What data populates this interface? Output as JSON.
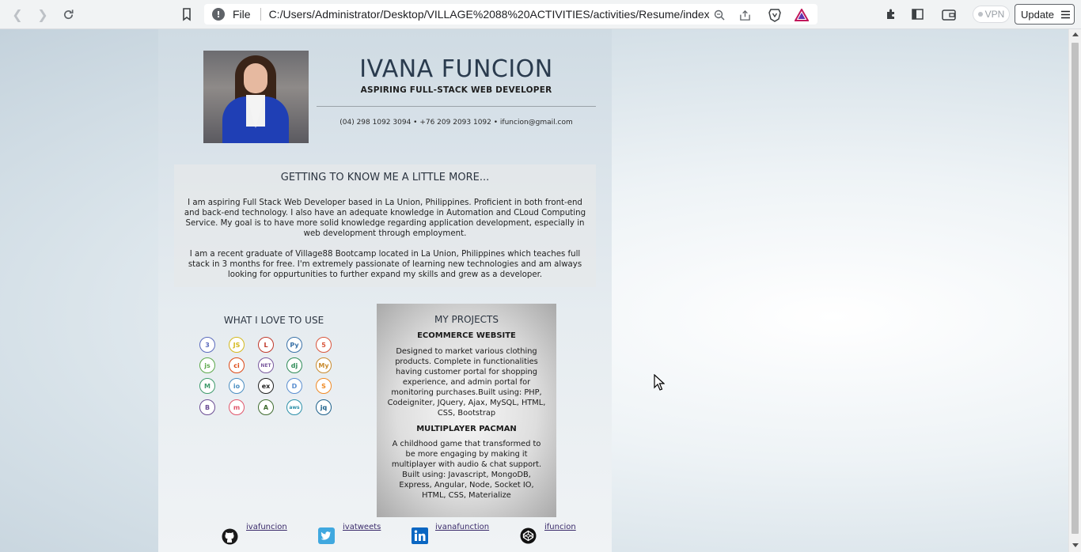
{
  "browser": {
    "url_scheme": "File",
    "url": "C:/Users/Administrator/Desktop/VILLAGE%2088%20ACTIVITIES/activities/Resume/index....",
    "vpn_label": "VPN",
    "update_label": "Update",
    "info_icon": "!"
  },
  "header": {
    "name": "IVANA FUNCION",
    "tagline": "ASPIRING FULL-STACK WEB DEVELOPER",
    "contact": "(04) 298 1092 3094 • +76 209 2093 1092 • ifuncion@gmail.com"
  },
  "about": {
    "title": "GETTING TO KNOW ME A LITTLE MORE...",
    "paragraphs": [
      "I am aspiring Full Stack Web Developer based in La Union, Philippines. Proficient in both front-end and back-end technology. I also have an adequate knowledge in Automation and CLoud Computing Service. My goal is to have more solid knowledge regarding application development, especially in web development through employment.",
      "I am a recent graduate of Village88 Bootcamp located in La Union, Philippines which teaches full stack in 3 months for free. I'm extremely passionate of learning new technologies and am always looking for oppurtunities to further expand my skills and grew as a developer."
    ]
  },
  "tools": {
    "title": "WHAT I LOVE TO USE",
    "icons": [
      {
        "name": "css3-icon",
        "glyph": "3",
        "color": "#5b6bbd"
      },
      {
        "name": "javascript-icon",
        "glyph": "JS",
        "color": "#d4b91e"
      },
      {
        "name": "laravel-icon",
        "glyph": "L",
        "color": "#c0392b"
      },
      {
        "name": "python-icon",
        "glyph": "Py",
        "color": "#3a72a8"
      },
      {
        "name": "html5-icon",
        "glyph": "5",
        "color": "#d9553b"
      },
      {
        "name": "nodejs-icon",
        "glyph": "js",
        "color": "#5ba84a"
      },
      {
        "name": "codeigniter-icon",
        "glyph": "ci",
        "color": "#dd4814"
      },
      {
        "name": "dotnet-icon",
        "glyph": "NET",
        "color": "#7a5a9e"
      },
      {
        "name": "django-icon",
        "glyph": "dj",
        "color": "#2e8b57"
      },
      {
        "name": "mysql-icon",
        "glyph": "My",
        "color": "#c88a2d"
      },
      {
        "name": "mongodb-icon",
        "glyph": "M",
        "color": "#3f9b6b"
      },
      {
        "name": "socketio-icon",
        "glyph": "io",
        "color": "#4a8ec2"
      },
      {
        "name": "express-icon",
        "glyph": "ex",
        "color": "#222222"
      },
      {
        "name": "docker-icon",
        "glyph": "D",
        "color": "#5a8ed0"
      },
      {
        "name": "swift-icon",
        "glyph": "S",
        "color": "#f08a24"
      },
      {
        "name": "bootstrap-icon",
        "glyph": "B",
        "color": "#6a4c93"
      },
      {
        "name": "materialize-icon",
        "glyph": "m",
        "color": "#e0556a"
      },
      {
        "name": "angular-icon",
        "glyph": "A",
        "color": "#3e6b2e"
      },
      {
        "name": "aws-icon",
        "glyph": "aws",
        "color": "#2a8fa8"
      },
      {
        "name": "jquery-icon",
        "glyph": "jq",
        "color": "#1b5f8a"
      }
    ]
  },
  "projects": {
    "title": "MY PROJECTS",
    "items": [
      {
        "name": "ECOMMERCE WEBSITE",
        "description": "Designed to market various clothing products. Complete in functionalities having customer portal for shopping experience, and admin portal for monitoring purchases.Built using: PHP, Codeigniter, JQuery, Ajax, MySQL, HTML, CSS, Bootstrap"
      },
      {
        "name": "MULTIPLAYER PACMAN",
        "description": "A childhood game that transformed to be more engaging by making it multiplayer with audio & chat support. Built using: Javascript, MongoDB, Express, Angular, Node, Socket IO, HTML, CSS, Materialize"
      }
    ]
  },
  "social": {
    "github": "ivafuncion",
    "twitter": "ivatweets",
    "linkedin": "ivanafunction",
    "codepen": "ifuncion"
  }
}
